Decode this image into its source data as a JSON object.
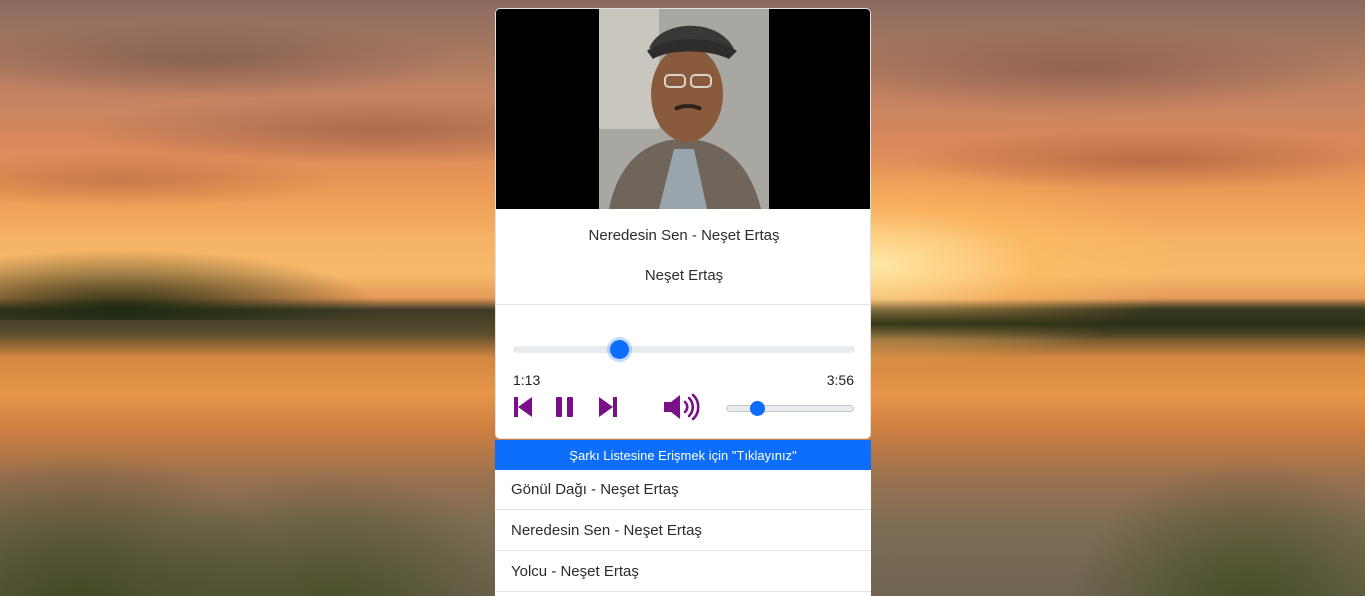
{
  "player": {
    "song_title": "Neredesin Sen - Neşet Ertaş",
    "artist": "Neşet Ertaş",
    "time_current": "1:13",
    "time_total": "3:56",
    "progress_fraction": 0.31,
    "volume_fraction": 0.24,
    "controls": {
      "previous_icon": "skip-back-icon",
      "pause_icon": "pause-icon",
      "next_icon": "skip-forward-icon",
      "volume_icon": "volume-high-icon"
    }
  },
  "playlist": {
    "header": "Şarkı Listesine Erişmek için \"Tıklayınız\"",
    "items": [
      {
        "label": "Gönül Dağı - Neşet Ertaş"
      },
      {
        "label": "Neredesin Sen - Neşet Ertaş"
      },
      {
        "label": "Yolcu - Neşet Ertaş"
      }
    ]
  },
  "colors": {
    "accent": "#0d6efd",
    "control_icon": "#7a0f8a"
  }
}
